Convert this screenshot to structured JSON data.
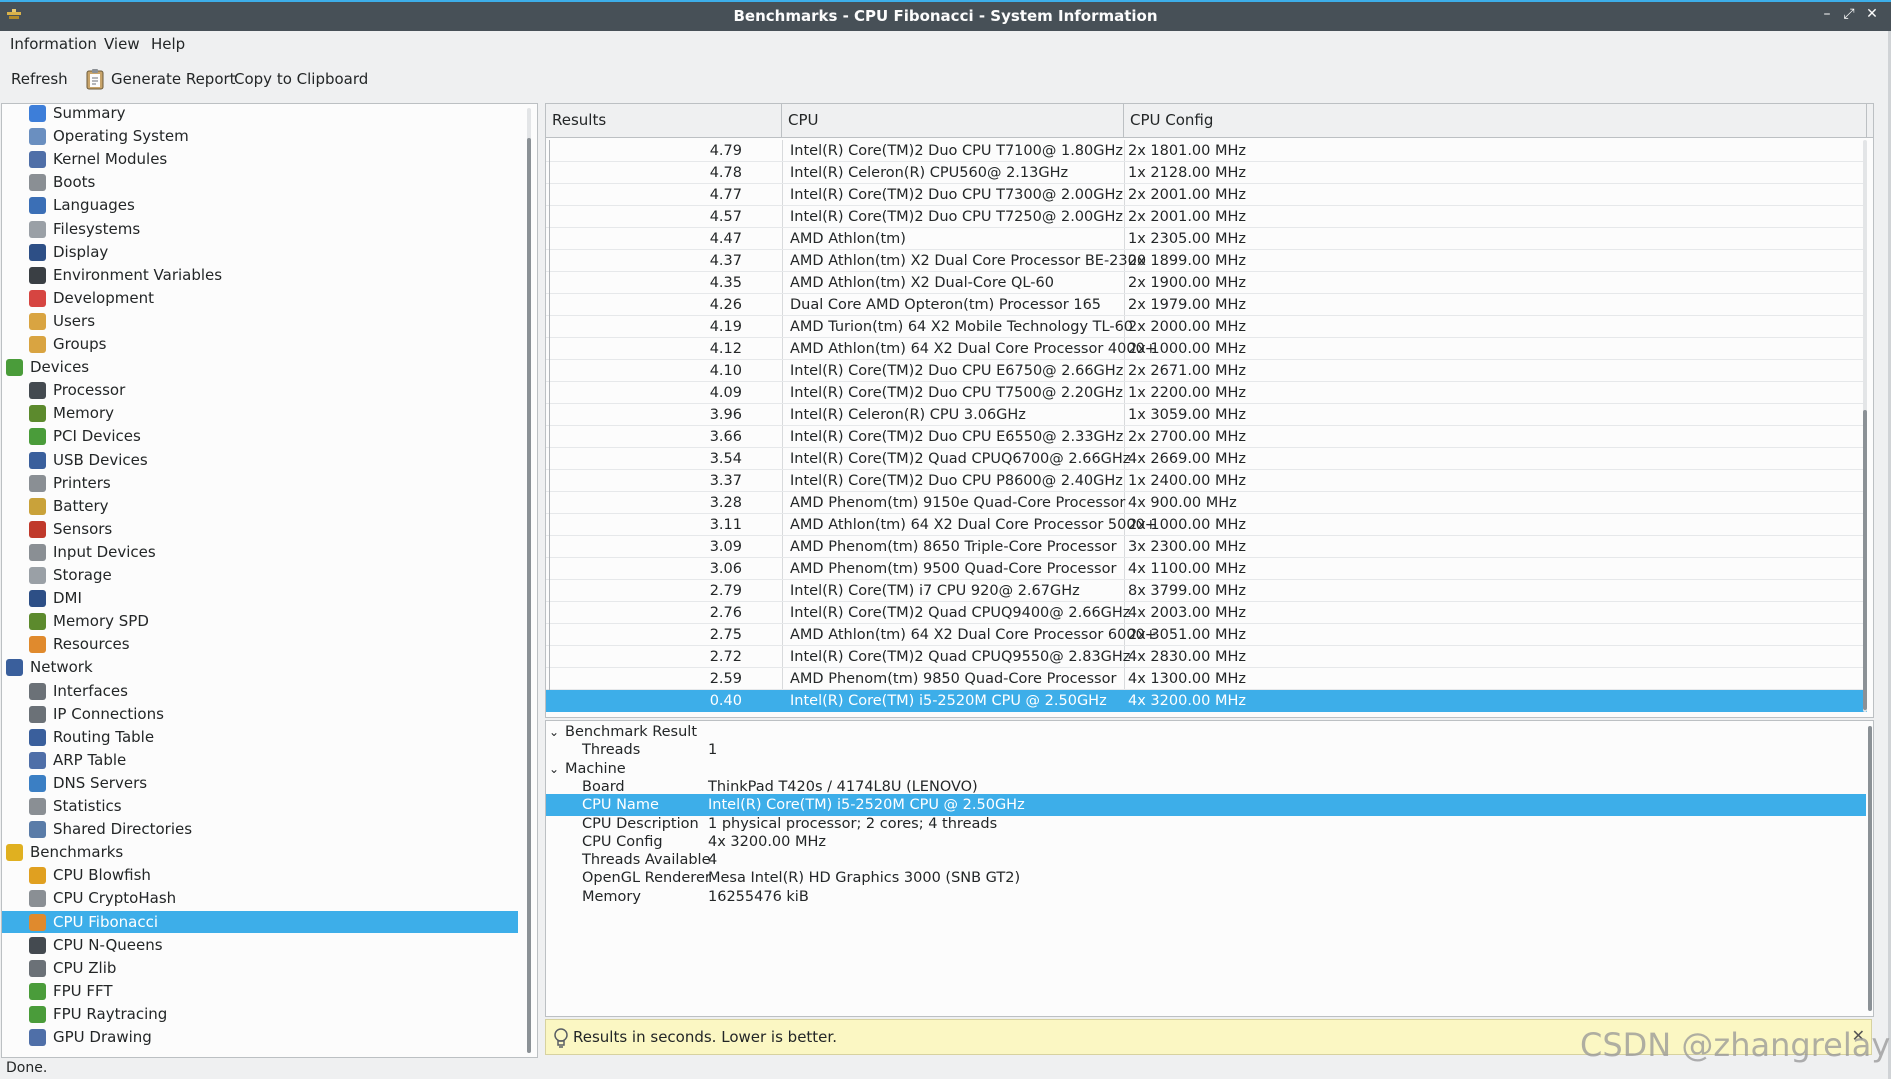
{
  "window": {
    "title": "Benchmarks - CPU Fibonacci - System Information"
  },
  "menu": {
    "items": [
      "Information",
      "View",
      "Help"
    ]
  },
  "toolbar": {
    "refresh": "Refresh",
    "report": "Generate Report",
    "copy": "Copy to Clipboard"
  },
  "sidebar": {
    "items": [
      {
        "label": "Summary",
        "icon": "info-icon",
        "color": "#3d7ed9",
        "level": 1
      },
      {
        "label": "Operating System",
        "icon": "gear-icon",
        "color": "#6a8fc0",
        "level": 1
      },
      {
        "label": "Kernel Modules",
        "icon": "diamond-icon",
        "color": "#4f6fa8",
        "level": 1
      },
      {
        "label": "Boots",
        "icon": "power-icon",
        "color": "#8a8f94",
        "level": 1
      },
      {
        "label": "Languages",
        "icon": "flag-icon",
        "color": "#3b6fb6",
        "level": 1
      },
      {
        "label": "Filesystems",
        "icon": "drive-icon",
        "color": "#9aa0a6",
        "level": 1
      },
      {
        "label": "Display",
        "icon": "monitor-icon",
        "color": "#2d4f86",
        "level": 1
      },
      {
        "label": "Environment Variables",
        "icon": "terminal-icon",
        "color": "#3a3f44",
        "level": 1
      },
      {
        "label": "Development",
        "icon": "toolbox-icon",
        "color": "#d64541",
        "level": 1
      },
      {
        "label": "Users",
        "icon": "users-icon",
        "color": "#d9a441",
        "level": 1
      },
      {
        "label": "Groups",
        "icon": "users-icon",
        "color": "#d9a441",
        "level": 1
      },
      {
        "label": "Devices",
        "icon": "board-icon",
        "color": "#4a9c3a",
        "level": 0
      },
      {
        "label": "Processor",
        "icon": "cpu-icon",
        "color": "#444a50",
        "level": 1
      },
      {
        "label": "Memory",
        "icon": "memory-icon",
        "color": "#5c8a2d",
        "level": 1
      },
      {
        "label": "PCI Devices",
        "icon": "board-icon",
        "color": "#4a9c3a",
        "level": 1
      },
      {
        "label": "USB Devices",
        "icon": "usb-icon",
        "color": "#3a5f9c",
        "level": 1
      },
      {
        "label": "Printers",
        "icon": "printer-icon",
        "color": "#8a8f94",
        "level": 1
      },
      {
        "label": "Battery",
        "icon": "battery-icon",
        "color": "#c9a23a",
        "level": 1
      },
      {
        "label": "Sensors",
        "icon": "thermometer-icon",
        "color": "#c0392b",
        "level": 1
      },
      {
        "label": "Input Devices",
        "icon": "keyboard-icon",
        "color": "#8a8f94",
        "level": 1
      },
      {
        "label": "Storage",
        "icon": "drive-icon",
        "color": "#9aa0a6",
        "level": 1
      },
      {
        "label": "DMI",
        "icon": "monitor-icon",
        "color": "#2d4f86",
        "level": 1
      },
      {
        "label": "Memory SPD",
        "icon": "memory-icon",
        "color": "#5c8a2d",
        "level": 1
      },
      {
        "label": "Resources",
        "icon": "diamond-icon",
        "color": "#e08a2d",
        "level": 1
      },
      {
        "label": "Network",
        "icon": "network-icon",
        "color": "#3a5f9c",
        "level": 0
      },
      {
        "label": "Interfaces",
        "icon": "cable-icon",
        "color": "#6b7177",
        "level": 1
      },
      {
        "label": "IP Connections",
        "icon": "plug-icon",
        "color": "#6b7177",
        "level": 1
      },
      {
        "label": "Routing Table",
        "icon": "network-icon",
        "color": "#3a5f9c",
        "level": 1
      },
      {
        "label": "ARP Table",
        "icon": "diamond-icon",
        "color": "#4f6fa8",
        "level": 1
      },
      {
        "label": "DNS Servers",
        "icon": "globe-icon",
        "color": "#3b7fc4",
        "level": 1
      },
      {
        "label": "Statistics",
        "icon": "stats-icon",
        "color": "#8a8f94",
        "level": 1
      },
      {
        "label": "Shared Directories",
        "icon": "folder-icon",
        "color": "#5a7ca8",
        "level": 1
      },
      {
        "label": "Benchmarks",
        "icon": "benchmark-icon",
        "color": "#e0b020",
        "level": 0
      },
      {
        "label": "CPU Blowfish",
        "icon": "fish-icon",
        "color": "#e0a020",
        "level": 1
      },
      {
        "label": "CPU CryptoHash",
        "icon": "key-icon",
        "color": "#8a8f94",
        "level": 1
      },
      {
        "label": "CPU Fibonacci",
        "icon": "shell-icon",
        "color": "#e08a2d",
        "level": 1,
        "selected": true
      },
      {
        "label": "CPU N-Queens",
        "icon": "chess-icon",
        "color": "#444a50",
        "level": 1
      },
      {
        "label": "CPU Zlib",
        "icon": "archive-icon",
        "color": "#6b7177",
        "level": 1
      },
      {
        "label": "FPU FFT",
        "icon": "wave-icon",
        "color": "#4a9c3a",
        "level": 1
      },
      {
        "label": "FPU Raytracing",
        "icon": "ray-icon",
        "color": "#4a9c3a",
        "level": 1
      },
      {
        "label": "GPU Drawing",
        "icon": "diamond-icon",
        "color": "#4f6fa8",
        "level": 1
      }
    ]
  },
  "results": {
    "columns": [
      "Results",
      "CPU",
      "CPU Config"
    ],
    "rows": [
      {
        "result": "4.79",
        "cpu": "Intel(R) Core(TM)2 Duo CPU T7100@ 1.80GHz",
        "config": "2x 1801.00 MHz"
      },
      {
        "result": "4.78",
        "cpu": "Intel(R) Celeron(R) CPU560@ 2.13GHz",
        "config": "1x 2128.00 MHz"
      },
      {
        "result": "4.77",
        "cpu": "Intel(R) Core(TM)2 Duo CPU T7300@ 2.00GHz",
        "config": "2x 2001.00 MHz"
      },
      {
        "result": "4.57",
        "cpu": "Intel(R) Core(TM)2 Duo CPU T7250@ 2.00GHz",
        "config": "2x 2001.00 MHz"
      },
      {
        "result": "4.47",
        "cpu": "AMD Athlon(tm)",
        "config": "1x 2305.00 MHz"
      },
      {
        "result": "4.37",
        "cpu": "AMD Athlon(tm) X2 Dual Core Processor BE-2300",
        "config": "2x 1899.00 MHz"
      },
      {
        "result": "4.35",
        "cpu": "AMD Athlon(tm) X2 Dual-Core QL-60",
        "config": "2x 1900.00 MHz"
      },
      {
        "result": "4.26",
        "cpu": "Dual Core AMD Opteron(tm) Processor 165",
        "config": "2x 1979.00 MHz"
      },
      {
        "result": "4.19",
        "cpu": "AMD Turion(tm) 64 X2 Mobile Technology TL-60",
        "config": "2x 2000.00 MHz"
      },
      {
        "result": "4.12",
        "cpu": "AMD Athlon(tm) 64 X2 Dual Core Processor 4000+",
        "config": "2x 1000.00 MHz"
      },
      {
        "result": "4.10",
        "cpu": "Intel(R) Core(TM)2 Duo CPU E6750@ 2.66GHz",
        "config": "2x 2671.00 MHz"
      },
      {
        "result": "4.09",
        "cpu": "Intel(R) Core(TM)2 Duo CPU T7500@ 2.20GHz",
        "config": "1x 2200.00 MHz"
      },
      {
        "result": "3.96",
        "cpu": "Intel(R) Celeron(R) CPU 3.06GHz",
        "config": "1x 3059.00 MHz"
      },
      {
        "result": "3.66",
        "cpu": "Intel(R) Core(TM)2 Duo CPU E6550@ 2.33GHz",
        "config": "2x 2700.00 MHz"
      },
      {
        "result": "3.54",
        "cpu": "Intel(R) Core(TM)2 Quad CPUQ6700@ 2.66GHz",
        "config": "4x 2669.00 MHz"
      },
      {
        "result": "3.37",
        "cpu": "Intel(R) Core(TM)2 Duo CPU P8600@ 2.40GHz",
        "config": "1x 2400.00 MHz"
      },
      {
        "result": "3.28",
        "cpu": "AMD Phenom(tm) 9150e Quad-Core Processor",
        "config": "4x 900.00 MHz"
      },
      {
        "result": "3.11",
        "cpu": "AMD Athlon(tm) 64 X2 Dual Core Processor 5000+",
        "config": "2x 1000.00 MHz"
      },
      {
        "result": "3.09",
        "cpu": "AMD Phenom(tm) 8650 Triple-Core Processor",
        "config": "3x 2300.00 MHz"
      },
      {
        "result": "3.06",
        "cpu": "AMD Phenom(tm) 9500 Quad-Core Processor",
        "config": "4x 1100.00 MHz"
      },
      {
        "result": "2.79",
        "cpu": "Intel(R) Core(TM) i7 CPU 920@ 2.67GHz",
        "config": "8x 3799.00 MHz"
      },
      {
        "result": "2.76",
        "cpu": "Intel(R) Core(TM)2 Quad CPUQ9400@ 2.66GHz",
        "config": "4x 2003.00 MHz"
      },
      {
        "result": "2.75",
        "cpu": "AMD Athlon(tm) 64 X2 Dual Core Processor 6000+",
        "config": "2x 3051.00 MHz"
      },
      {
        "result": "2.72",
        "cpu": "Intel(R) Core(TM)2 Quad CPUQ9550@ 2.83GHz",
        "config": "4x 2830.00 MHz"
      },
      {
        "result": "2.59",
        "cpu": "AMD Phenom(tm) 9850 Quad-Core Processor",
        "config": "4x 1300.00 MHz"
      },
      {
        "result": "0.40",
        "cpu": "Intel(R) Core(TM) i5-2520M CPU @ 2.50GHz",
        "config": "4x 3200.00 MHz",
        "selected": true
      }
    ]
  },
  "details": {
    "sections": [
      {
        "title": "Benchmark Result",
        "rows": [
          {
            "key": "Threads",
            "value": "1"
          }
        ]
      },
      {
        "title": "Machine",
        "rows": [
          {
            "key": "Board",
            "value": "ThinkPad T420s / 4174L8U (LENOVO)"
          },
          {
            "key": "CPU Name",
            "value": "Intel(R) Core(TM) i5-2520M CPU @ 2.50GHz",
            "selected": true
          },
          {
            "key": "CPU Description",
            "value": "1 physical processor; 2 cores; 4 threads"
          },
          {
            "key": "CPU Config",
            "value": "4x 3200.00 MHz"
          },
          {
            "key": "Threads Available",
            "value": "4"
          },
          {
            "key": "OpenGL Renderer",
            "value": "Mesa Intel(R) HD Graphics 3000 (SNB GT2)"
          },
          {
            "key": "Memory",
            "value": "16255476 kiB"
          }
        ]
      }
    ]
  },
  "note": {
    "text": "Results in seconds. Lower is better."
  },
  "status": {
    "text": "Done."
  },
  "watermark": "CSDN @zhangrelay",
  "colors": {
    "accent": "#3daee9",
    "titlebar": "#475057",
    "note_bg": "#fbf7c3"
  }
}
